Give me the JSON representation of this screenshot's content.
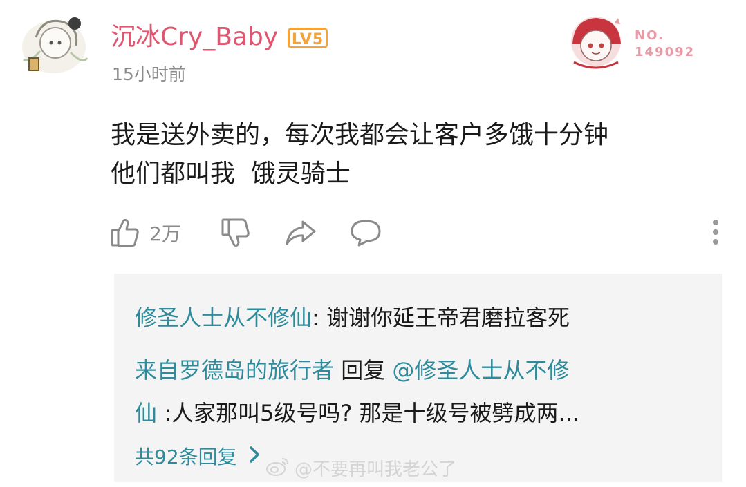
{
  "post": {
    "username": "沉冰Cry_Baby",
    "level": "LV5",
    "timestamp": "15小时前",
    "fan_label": "NO.",
    "fan_number": "149092",
    "comment_lines": [
      "我是送外卖的，每次我都会让客户多饿十分钟",
      "他们都叫我  饿灵骑士"
    ]
  },
  "actions": {
    "like_count": "2万"
  },
  "replies": {
    "reply1_name": "修圣人士从不修仙",
    "reply1_text": ": 谢谢你延王帝君磨拉客死",
    "reply2_name": "来自罗德岛的旅行者",
    "reply2_mid": " 回复 ",
    "reply2_target_a": "@修圣人士从不修",
    "reply2_target_b": "仙",
    "reply2_text": " :人家那叫5级号吗? 那是十级号被劈成两...",
    "more_label": "共92条回复"
  },
  "watermark": "@不要再叫我老公了",
  "colors": {
    "username": "#e0556f",
    "level_badge": "#f4a23a",
    "reply_name": "#2e8b9b",
    "reply_bg": "#f4f4f4"
  },
  "icons": [
    "thumbs-up-icon",
    "thumbs-down-icon",
    "share-icon",
    "comment-icon",
    "more-vertical-icon",
    "chevron-right-icon",
    "weibo-icon"
  ]
}
